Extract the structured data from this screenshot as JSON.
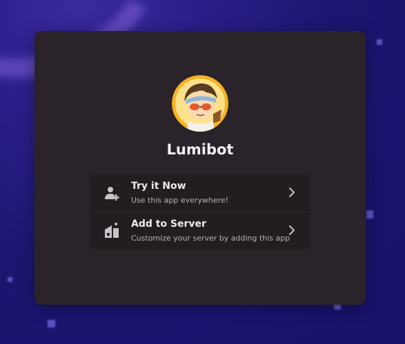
{
  "app": {
    "name": "Lumibot",
    "avatar_icon": "bot-avatar-icon"
  },
  "options": [
    {
      "title": "Try it Now",
      "subtitle": "Use this app everywhere!",
      "icon": "user-add-icon"
    },
    {
      "title": "Add to Server",
      "subtitle": "Customize your server by adding this app",
      "icon": "server-add-icon"
    }
  ],
  "colors": {
    "background": "#1c1670",
    "modal": "#2a2329",
    "options_panel": "#231d22",
    "text_primary": "#ece9ef",
    "text_secondary": "#b7b0b8",
    "icon": "#c9c3cb"
  }
}
